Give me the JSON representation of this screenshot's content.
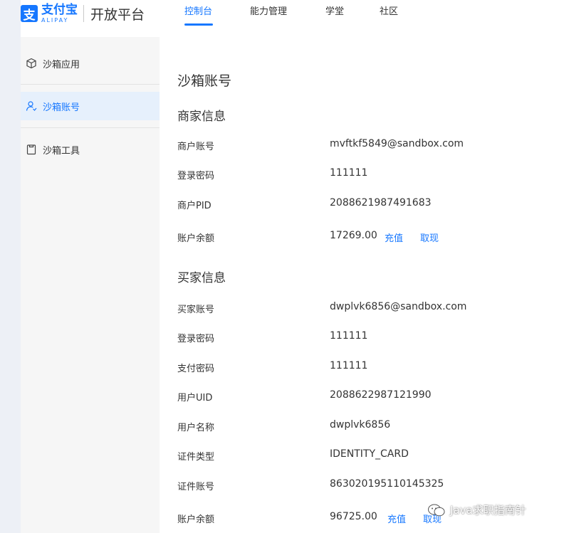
{
  "header": {
    "logo_cn": "支付宝",
    "logo_en": "ALIPAY",
    "platform": "开放平台",
    "nav": [
      {
        "label": "控制台",
        "active": true
      },
      {
        "label": "能力管理",
        "active": false
      },
      {
        "label": "学堂",
        "active": false
      },
      {
        "label": "社区",
        "active": false
      }
    ]
  },
  "sidebar": {
    "items": [
      {
        "label": "沙箱应用",
        "icon": "cube-icon",
        "active": false
      },
      {
        "label": "沙箱账号",
        "icon": "user-icon",
        "active": true
      },
      {
        "label": "沙箱工具",
        "icon": "clipboard-icon",
        "active": false
      }
    ]
  },
  "main": {
    "title": "沙箱账号",
    "merchant": {
      "title": "商家信息",
      "rows": [
        {
          "label": "商户账号",
          "value": "mvftkf5849@sandbox.com"
        },
        {
          "label": "登录密码",
          "value": "111111"
        },
        {
          "label": "商户PID",
          "value": "2088621987491683"
        },
        {
          "label": "账户余额",
          "value": "17269.00"
        }
      ],
      "recharge": "充值",
      "withdraw": "取现"
    },
    "buyer": {
      "title": "买家信息",
      "rows": [
        {
          "label": "买家账号",
          "value": "dwplvk6856@sandbox.com"
        },
        {
          "label": "登录密码",
          "value": "111111"
        },
        {
          "label": "支付密码",
          "value": "111111"
        },
        {
          "label": "用户UID",
          "value": "2088622987121990"
        },
        {
          "label": "用户名称",
          "value": "dwplvk6856"
        },
        {
          "label": "证件类型",
          "value": "IDENTITY_CARD"
        },
        {
          "label": "证件账号",
          "value": "863020195110145325"
        },
        {
          "label": "账户余额",
          "value": "96725.00"
        }
      ],
      "recharge": "充值",
      "withdraw": "取现"
    }
  },
  "watermark": "Java求职指南针",
  "colors": {
    "accent": "#1677ff",
    "sidebar_bg": "#f6f6f6",
    "active_bg": "#e6f0fc"
  }
}
